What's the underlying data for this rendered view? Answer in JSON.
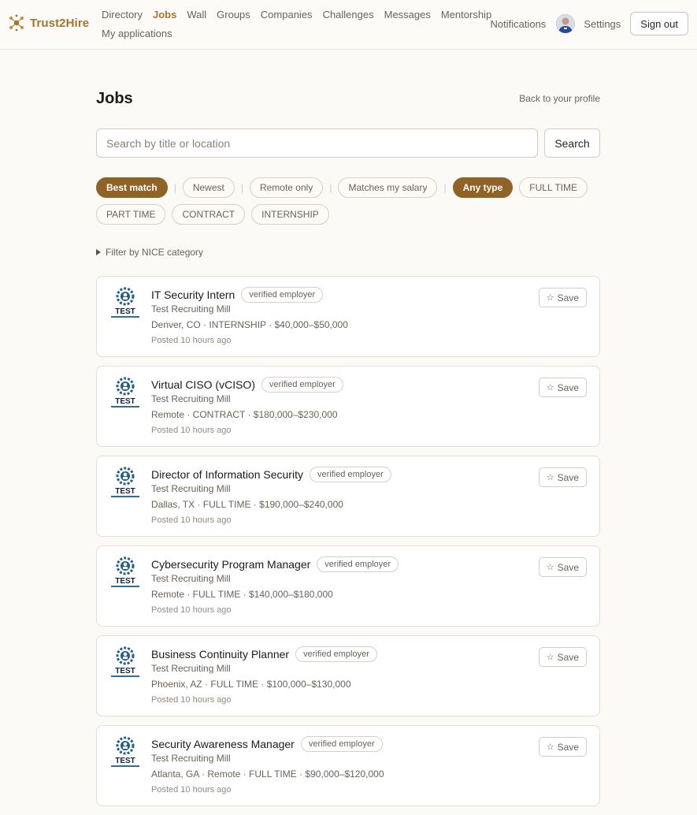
{
  "brand": {
    "name": "Trust2Hire",
    "color": "#a2752f"
  },
  "nav": {
    "row1": [
      "Directory",
      "Jobs",
      "Wall",
      "Groups",
      "Companies",
      "Challenges",
      "Messages",
      "Mentorship"
    ],
    "row2": [
      "My applications"
    ],
    "active": "Jobs"
  },
  "topRight": {
    "notifications": "Notifications",
    "settings": "Settings",
    "signout": "Sign out"
  },
  "page": {
    "title": "Jobs",
    "back": "Back to your profile"
  },
  "search": {
    "placeholder": "Search by title or location",
    "value": "",
    "button": "Search"
  },
  "filters": {
    "sort": [
      {
        "label": "Best match",
        "on": true
      },
      {
        "label": "Newest",
        "on": false
      },
      {
        "label": "Remote only",
        "on": false
      },
      {
        "label": "Matches my salary",
        "on": false
      }
    ],
    "types": [
      {
        "label": "Any type",
        "on": true
      },
      {
        "label": "FULL TIME",
        "on": false
      },
      {
        "label": "PART TIME",
        "on": false
      },
      {
        "label": "CONTRACT",
        "on": false
      },
      {
        "label": "INTERNSHIP",
        "on": false
      }
    ],
    "nice": "Filter by NICE category"
  },
  "jobs": [
    {
      "title": "IT Security Intern",
      "badge": "verified employer",
      "company": "Test Recruiting Mill",
      "meta": "Denver, CO · INTERNSHIP · $40,000–$50,000",
      "posted": "Posted 10 hours ago",
      "save": "Save"
    },
    {
      "title": "Virtual CISO (vCISO)",
      "badge": "verified employer",
      "company": "Test Recruiting Mill",
      "meta": "Remote · CONTRACT · $180,000–$230,000",
      "posted": "Posted 10 hours ago",
      "save": "Save"
    },
    {
      "title": "Director of Information Security",
      "badge": "verified employer",
      "company": "Test Recruiting Mill",
      "meta": "Dallas, TX · FULL TIME · $190,000–$240,000",
      "posted": "Posted 10 hours ago",
      "save": "Save"
    },
    {
      "title": "Cybersecurity Program Manager",
      "badge": "verified employer",
      "company": "Test Recruiting Mill",
      "meta": "Remote · FULL TIME · $140,000–$180,000",
      "posted": "Posted 10 hours ago",
      "save": "Save"
    },
    {
      "title": "Business Continuity Planner",
      "badge": "verified employer",
      "company": "Test Recruiting Mill",
      "meta": "Phoenix, AZ · FULL TIME · $100,000–$130,000",
      "posted": "Posted 10 hours ago",
      "save": "Save"
    },
    {
      "title": "Security Awareness Manager",
      "badge": "verified employer",
      "company": "Test Recruiting Mill",
      "meta": "Atlanta, GA · Remote · FULL TIME · $90,000–$120,000",
      "posted": "Posted 10 hours ago",
      "save": "Save"
    }
  ],
  "logoText": "TEST",
  "colors": {
    "accent": "#8e6325",
    "background": "#fcfaf6"
  }
}
